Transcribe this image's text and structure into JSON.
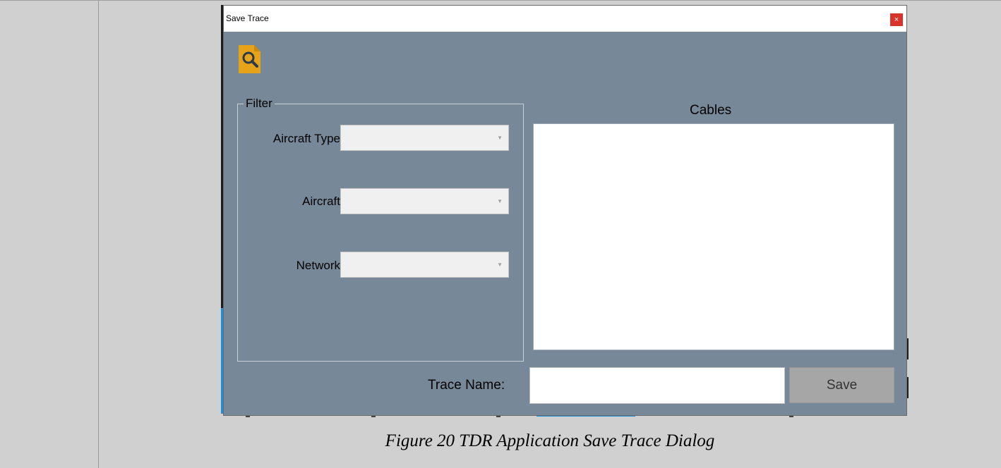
{
  "dialog": {
    "title": "Save Trace",
    "close_symbol": "×",
    "icon": "document-search-icon",
    "accent_color": "#e6a31a",
    "background_color": "#778899"
  },
  "filter": {
    "group_label": "Filter",
    "fields": [
      {
        "label": "Aircraft Type",
        "value": ""
      },
      {
        "label": "Aircraft",
        "value": ""
      },
      {
        "label": "Network",
        "value": ""
      }
    ]
  },
  "cables": {
    "title": "Cables",
    "items": []
  },
  "trace": {
    "label": "Trace Name:",
    "value": ""
  },
  "actions": {
    "save_label": "Save"
  },
  "caption": "Figure 20 TDR Application Save Trace Dialog"
}
